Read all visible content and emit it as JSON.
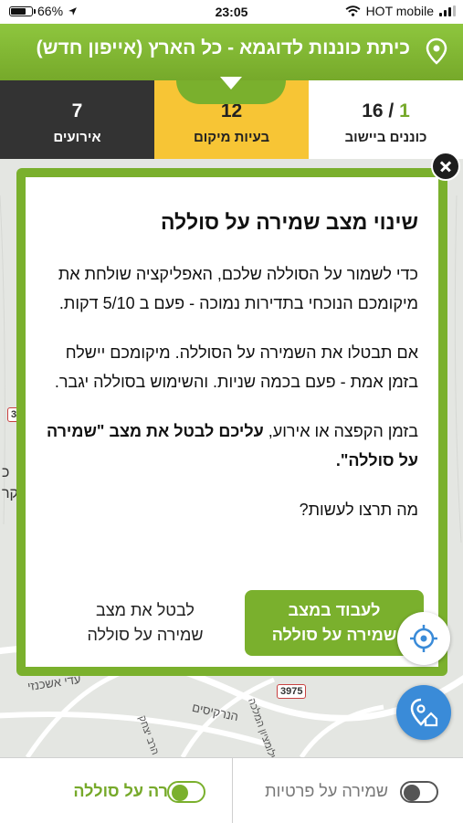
{
  "status_bar": {
    "battery": "66%",
    "battery_level": 0.66,
    "time": "23:05",
    "carrier": "HOT mobile"
  },
  "header": {
    "title": "כיתת כוננות לדוגמא - כל הארץ (אייפון חדש)"
  },
  "stats": {
    "events": {
      "value": "7",
      "label": "אירועים"
    },
    "location_issues": {
      "value": "12",
      "label": "בעיות מיקום"
    },
    "settlement_standby": {
      "available": "1",
      "separator": "/",
      "total": "16",
      "label": "כוננים ביישוב"
    }
  },
  "map": {
    "road_badges": [
      "3975",
      "3"
    ],
    "street_labels": [
      "עדי אשכנזי",
      "הנרקיסים",
      "שלומציון המלכה",
      "הרב יצחק",
      "כ",
      "קר"
    ]
  },
  "modal": {
    "title": "שינוי מצב שמירה על סוללה",
    "paragraph1": "כדי לשמור על הסוללה שלכם, האפליקציה שולחת את מיקומכם הנוכחי בתדירות נמוכה - פעם ב 5/10 דקות.",
    "paragraph2": "אם תבטלו את השמירה על הסוללה. מיקומכם יישלח בזמן אמת - פעם בכמה שניות. והשימוש בסוללה יגבר.",
    "paragraph3_start": "בזמן הקפצה או אירוע,",
    "paragraph3_bold": "עליכם לבטל את מצב \"שמירה על סוללה\".",
    "question": "מה תרצו לעשות?",
    "primary_line1": "לעבוד במצב",
    "primary_line2": "שמירה על סוללה",
    "secondary_line1": "לבטל את מצב",
    "secondary_line2": "שמירה על סוללה"
  },
  "bottom_bar": {
    "battery_saving": {
      "label": "שמירה על סוללה",
      "enabled": true
    },
    "privacy_saving": {
      "label": "שמירה על פרטיות",
      "enabled": false
    }
  },
  "colors": {
    "brand_green": "#7ab02d",
    "events_dark": "#333333",
    "location_yellow": "#f7c535",
    "guard_blue": "#3a8bd8"
  }
}
